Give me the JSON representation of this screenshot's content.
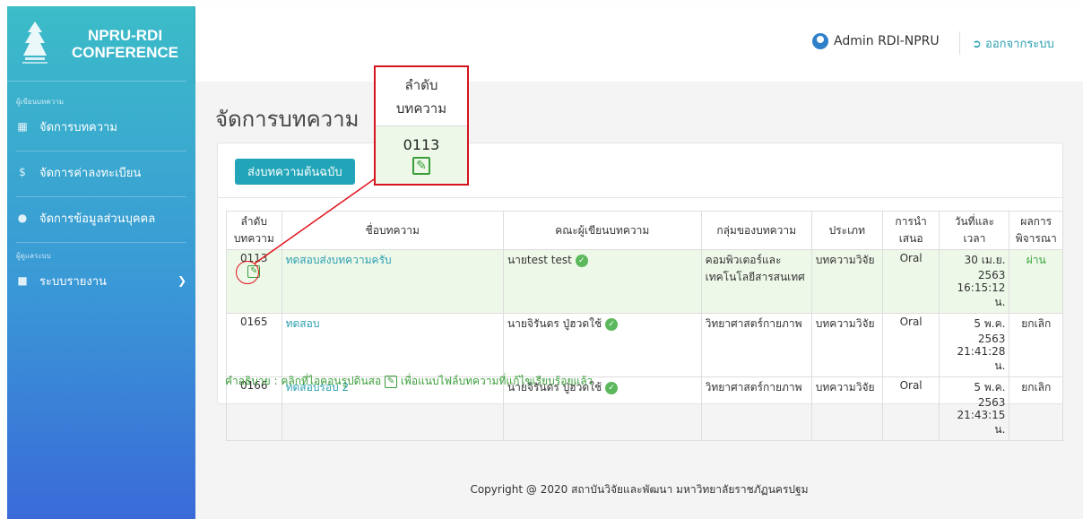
{
  "brand": {
    "line1": "NPRU-RDI",
    "line2": "CONFERENCE"
  },
  "sidebar": {
    "section1_title": "ผู้เขียนบทความ",
    "items": [
      {
        "label": "จัดการบทความ",
        "icon": "table-icon"
      },
      {
        "label": "จัดการค่าลงทะเบียน",
        "icon": "dollar-icon"
      },
      {
        "label": "จัดการข้อมูลส่วนบุคคล",
        "icon": "user-icon"
      }
    ],
    "section2_title": "ผู้ดูแลระบบ",
    "report": {
      "label": "ระบบรายงาน",
      "icon": "folder-icon"
    }
  },
  "topbar": {
    "admin": "Admin RDI-NPRU",
    "logout": "ออกจากระบบ"
  },
  "page": {
    "title": "จัดการบทความ",
    "submit_button": "ส่งบทความต้นฉบับ"
  },
  "table": {
    "headers": [
      "ลำดับ บทความ",
      "ชื่อบทความ",
      "คณะผู้เขียนบทความ",
      "กลุ่มของบทความ",
      "ประเภท",
      "การนำเสนอ",
      "วันที่และเวลา",
      "ผลการ พิจารณา"
    ],
    "rows": [
      {
        "no": "0113",
        "title": "ทดสอบส่งบทความครับ",
        "author": "นายtest test",
        "group": "คอมพิวเตอร์และเทคโนโลยีสารสนเทศ",
        "type": "บทความวิจัย",
        "presentation": "Oral",
        "date": "30 เม.ย. 2563",
        "time": "16:15:12 น.",
        "result": "ผ่าน"
      },
      {
        "no": "0165",
        "title": "ทดสอบ",
        "author": "นายจิรันดร ปู่ฮวดใช้",
        "group": "วิทยาศาสตร์กายภาพ",
        "type": "บทความวิจัย",
        "presentation": "Oral",
        "date": "5 พ.ค. 2563",
        "time": "21:41:28 น.",
        "result": "ยกเลิก"
      },
      {
        "no": "0166",
        "title": "ทดสอบรอบ 2",
        "author": "นายจิรันดร ปู่ฮวดใช้",
        "group": "วิทยาศาสตร์กายภาพ",
        "type": "บทความวิจัย",
        "presentation": "Oral",
        "date": "5 พ.ค. 2563",
        "time": "21:43:15 น.",
        "result": "ยกเลิก"
      }
    ]
  },
  "note": {
    "before": "คำอธิบาย : คลิกที่ไอคอนรูปดินสอ",
    "after": "เพื่อแนบไฟล์บทความที่แก้ไขเรียบร้อยแล้ว"
  },
  "footer": "Copyright @ 2020 สถาบันวิจัยและพัฒนา มหาวิทยาลัยราชภัฏนครปฐม",
  "callout": {
    "head1": "ลำดับ",
    "head2": "บทความ",
    "no": "0113"
  },
  "colors": {
    "accent": "#22a5b8",
    "pass": "#3aa63a",
    "callout": "#d6141e"
  }
}
